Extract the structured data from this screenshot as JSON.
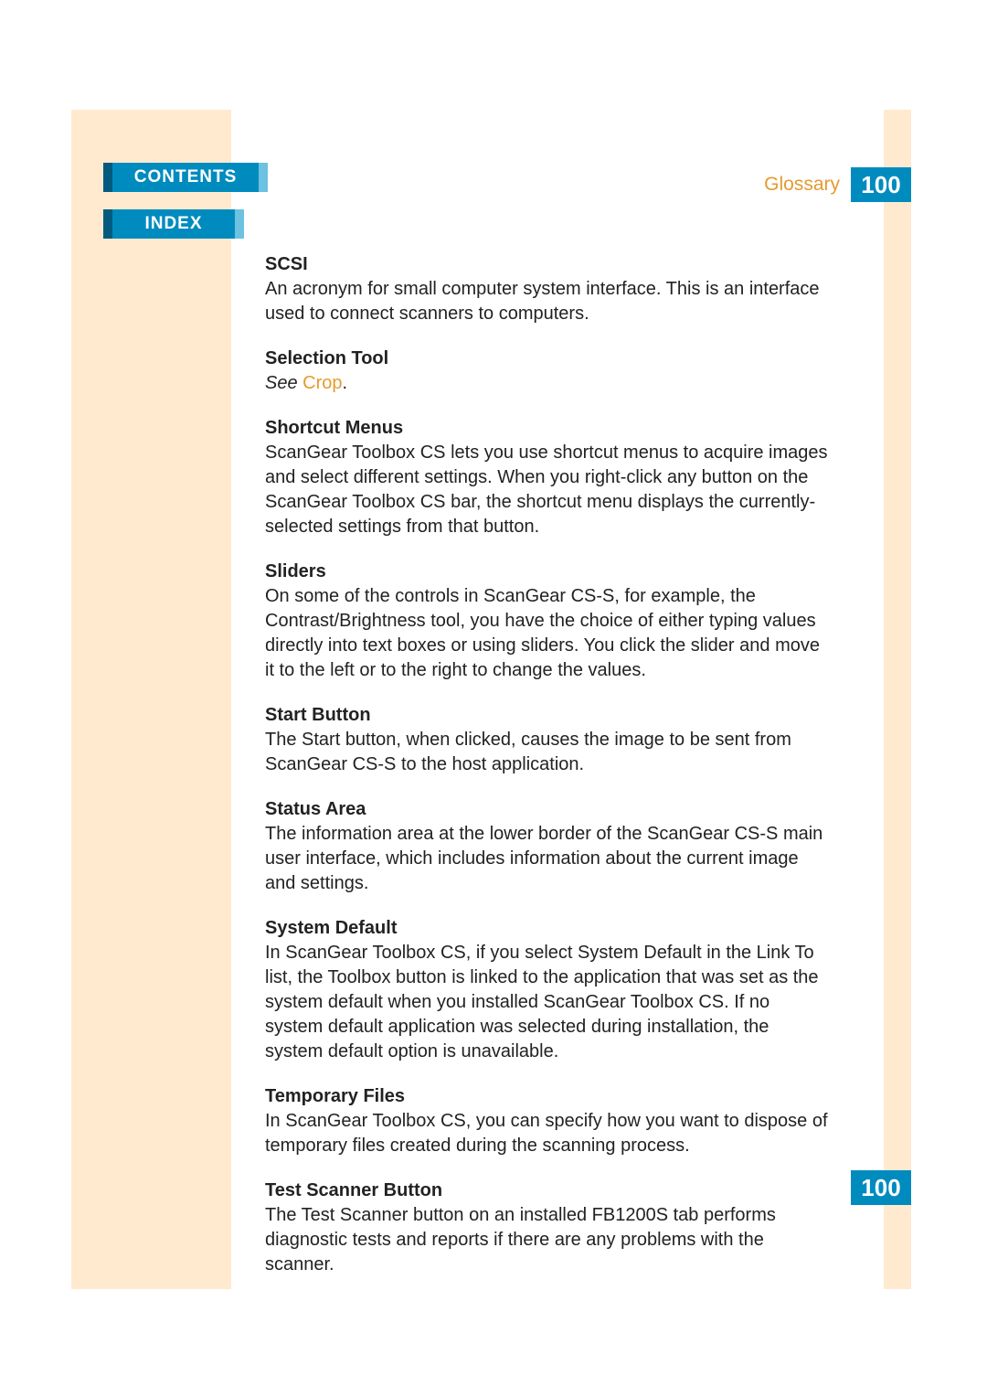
{
  "nav": {
    "contents": "CONTENTS",
    "index": "INDEX"
  },
  "header": {
    "section": "Glossary",
    "page": "100"
  },
  "footer": {
    "page": "100"
  },
  "entries": [
    {
      "term": "SCSI",
      "def": "An acronym for small computer system interface. This is an interface used to connect scanners to computers."
    },
    {
      "term": "Selection Tool",
      "see_prefix": "See ",
      "see_link": "Crop",
      "see_suffix": "."
    },
    {
      "term": "Shortcut Menus",
      "def": "ScanGear Toolbox CS lets you use shortcut menus to acquire images and select different settings. When you right-click any button on the ScanGear Toolbox CS bar, the shortcut menu displays the currently-selected settings from that button."
    },
    {
      "term": "Sliders",
      "def": "On some of the controls in ScanGear CS-S, for example, the Contrast/Brightness tool, you have the choice of either typing values directly into text boxes or using sliders. You click the slider and move it to the left or to the right to change the values."
    },
    {
      "term": "Start Button",
      "def": "The Start button, when clicked, causes the image to be sent from ScanGear CS-S to the host application."
    },
    {
      "term": "Status Area",
      "def": "The information area at the lower border of the ScanGear CS-S main user interface, which includes information about the current image and settings."
    },
    {
      "term": "System Default",
      "def": "In ScanGear Toolbox CS, if you select System Default in the Link To list, the Toolbox button is linked to the application that was set as the system default when you installed ScanGear Toolbox CS. If no system default application was selected during installation, the system default option is unavailable."
    },
    {
      "term": "Temporary Files",
      "def": "In ScanGear Toolbox CS, you can specify how you want to dispose of temporary files created during the scanning process."
    },
    {
      "term": "Test Scanner Button",
      "def": "The Test Scanner button on an installed FB1200S tab performs diagnostic tests and reports if there are any problems with the scanner."
    }
  ]
}
